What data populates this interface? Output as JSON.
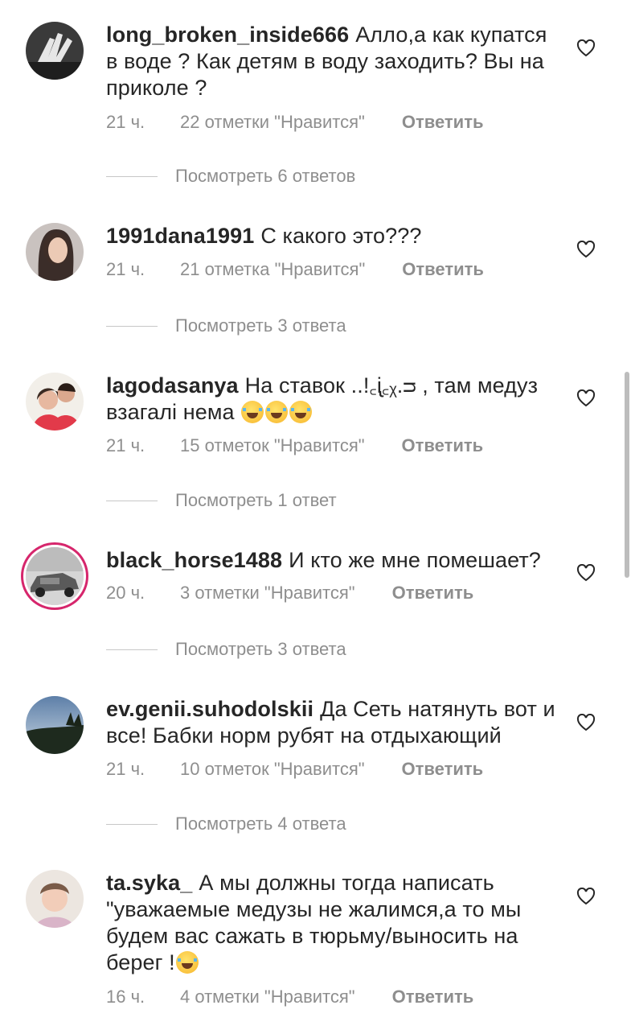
{
  "comments": [
    {
      "username": "long_broken_inside666",
      "text": "Алло,а как купатся в воде ? Как детям в воду заходить?  Вы на приколе ?",
      "time": "21 ч.",
      "likes": "22 отметки \"Нравится\"",
      "reply": "Ответить",
      "view_replies": "Посмотреть 6 ответов"
    },
    {
      "username": "1991dana1991",
      "text": "С какого это???",
      "time": "21 ч.",
      "likes": "21 отметка \"Нравится\"",
      "reply": "Ответить",
      "view_replies": "Посмотреть 3 ответа"
    },
    {
      "username": "lagodasanya",
      "text": "На ставок ..!꜀ᶖ꜀ᵪ.ᴝ , там медуз взагалі нема",
      "time": "21 ч.",
      "likes": "15 отметок \"Нравится\"",
      "reply": "Ответить",
      "view_replies": "Посмотреть 1 ответ"
    },
    {
      "username": "black_horse1488",
      "text": "И кто же мне помешает?",
      "time": "20 ч.",
      "likes": "3 отметки \"Нравится\"",
      "reply": "Ответить",
      "view_replies": "Посмотреть 3 ответа"
    },
    {
      "username": "ev.genii.suhodolskii",
      "text": "Да Сеть натянуть вот и все! Бабки норм рубят на отдыхающий",
      "time": "21 ч.",
      "likes": "10 отметок \"Нравится\"",
      "reply": "Ответить",
      "view_replies": "Посмотреть 4 ответа"
    },
    {
      "username": "ta.syka_",
      "text": "А мы должны тогда написать \"уважаемые медузы не жалимся,а то мы будем вас сажать в тюрьму/выносить на берег !",
      "time": "16 ч.",
      "likes": "4 отметки \"Нравится\"",
      "reply": "Ответить"
    }
  ]
}
